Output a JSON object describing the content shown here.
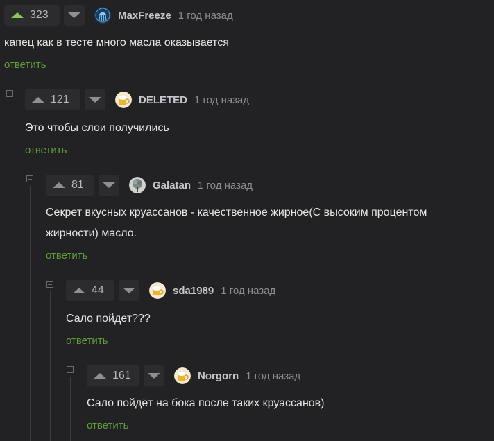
{
  "reply_label": "ответить",
  "colors": {
    "background": "#222224",
    "upvote_active": "#8ac858",
    "reply_link": "#5f9e3a"
  },
  "comments": [
    {
      "rating": "323",
      "username": "MaxFreeze",
      "time": "1 год назад",
      "text": "капец как в тесте много масла оказывается",
      "avatar_icon": "jellyfish-avatar-icon"
    },
    {
      "rating": "121",
      "username": "DELETED",
      "time": "1 год назад",
      "text": "Это чтобы слои получились",
      "avatar_icon": "beer-mug-avatar-icon"
    },
    {
      "rating": "81",
      "username": "Galatan",
      "time": "1 год назад",
      "text_line1": "Секрет вкусных круассанов - качественное жирное(С высоким процентом",
      "text_line2": "жирности) масло.",
      "avatar_icon": "tree-avatar-icon"
    },
    {
      "rating": "44",
      "username": "sda1989",
      "time": "1 год назад",
      "text": "Сало пойдет???",
      "avatar_icon": "beer-mug-avatar-icon"
    },
    {
      "rating": "161",
      "username": "Norgorn",
      "time": "1 год назад",
      "text": "Сало пойдёт на бока после таких круассанов)",
      "avatar_icon": "beer-mug-avatar-icon"
    }
  ]
}
